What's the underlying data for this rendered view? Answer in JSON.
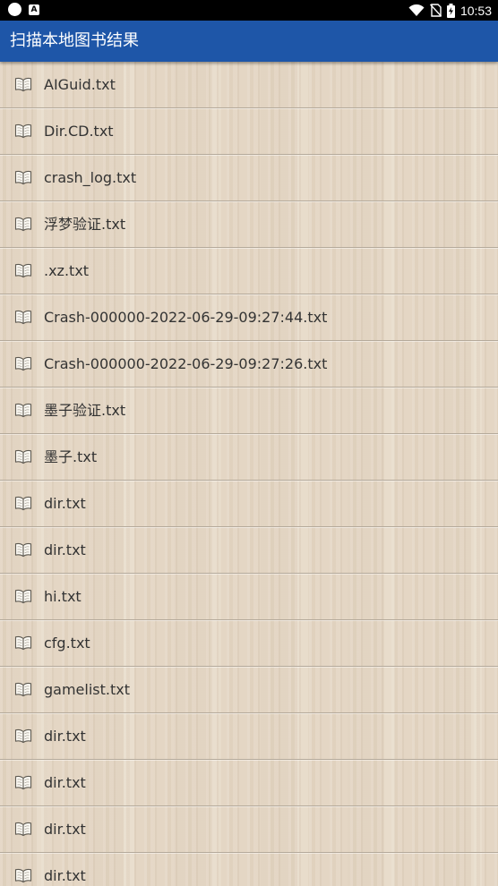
{
  "status_bar": {
    "time": "10:53",
    "icons": [
      "circle-icon",
      "a-notification-icon",
      "wifi-icon",
      "no-sim-icon",
      "battery-icon"
    ]
  },
  "app_bar": {
    "title": "扫描本地图书结果"
  },
  "file_list": {
    "item_icon": "book-icon",
    "items": [
      {
        "name": "AIGuid.txt"
      },
      {
        "name": "Dir.CD.txt"
      },
      {
        "name": "crash_log.txt"
      },
      {
        "name": "浮梦验证.txt"
      },
      {
        "name": ".xz.txt"
      },
      {
        "name": "Crash-000000-2022-06-29-09:27:44.txt"
      },
      {
        "name": "Crash-000000-2022-06-29-09:27:26.txt"
      },
      {
        "name": "墨子验证.txt"
      },
      {
        "name": "墨子.txt"
      },
      {
        "name": "dir.txt"
      },
      {
        "name": "dir.txt"
      },
      {
        "name": "hi.txt"
      },
      {
        "name": "cfg.txt"
      },
      {
        "name": "gamelist.txt"
      },
      {
        "name": "dir.txt"
      },
      {
        "name": "dir.txt"
      },
      {
        "name": "dir.txt"
      },
      {
        "name": "dir.txt"
      }
    ]
  },
  "colors": {
    "app_bar": "#1e56a8",
    "status_bar": "#000000",
    "background": "#e6d9c7",
    "text": "#333333",
    "divider": "#b5aa9b"
  }
}
